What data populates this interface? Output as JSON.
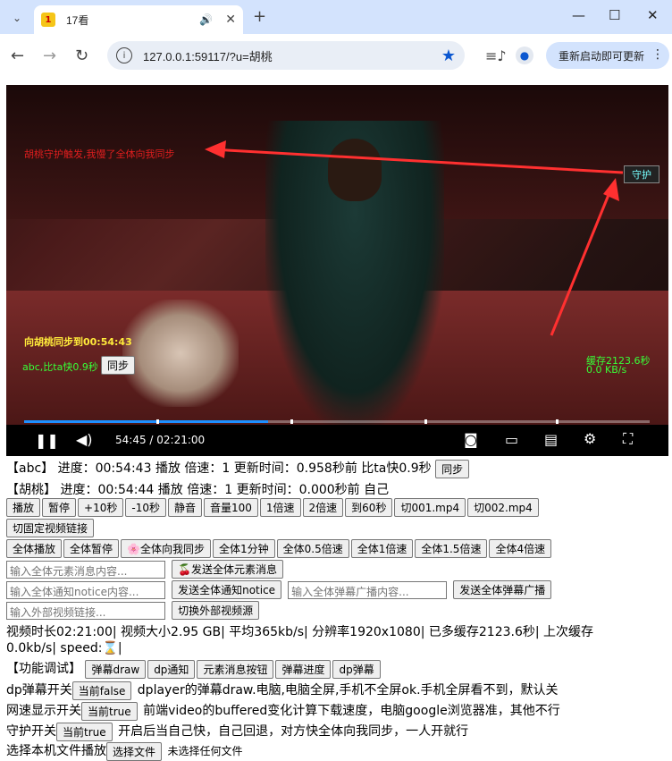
{
  "browser": {
    "tab_title": "17看",
    "url": "127.0.0.1:59117/?u=胡桃",
    "restart_label": "重新启动即可更新"
  },
  "player": {
    "guard_msg": "胡桃守护触发,我慢了全体向我同步",
    "guard_btn": "守护",
    "sync_msg": "向胡桃同步到00:54:43",
    "abc_msg": "abc,比ta快0.9秒",
    "sync_btn": "同步",
    "cache_msg": "缓存2123.6秒",
    "speed_msg": "0.0 KB/s",
    "time": "54:45 / 02:21:00",
    "progress": 0.39
  },
  "status": {
    "abc_line": "【abc】 进度：00:54:43 播放 倍速：1 更新时间：0.958秒前 比ta快0.9秒",
    "abc_btn": "同步",
    "hutao_line": "【胡桃】 进度：00:54:44 播放 倍速：1 更新时间：0.000秒前 自己"
  },
  "row1": [
    "播放",
    "暂停",
    "+10秒",
    "-10秒",
    "静音",
    "音量100",
    "1倍速",
    "2倍速",
    "到60秒",
    "切001.mp4",
    "切002.mp4"
  ],
  "row2": [
    "切固定视频链接"
  ],
  "row3": [
    "全体播放",
    "全体暂停",
    "🌸全体向我同步",
    "全体1分钟",
    "全体0.5倍速",
    "全体1倍速",
    "全体1.5倍速",
    "全体4倍速"
  ],
  "inputs": {
    "elem_ph": "输入全体元素消息内容...",
    "elem_btn": "🍒发送全体元素消息",
    "notice_ph": "输入全体通知notice内容...",
    "notice_btn": "发送全体通知notice",
    "danmu_ph": "输入全体弹幕广播内容...",
    "danmu_btn": "发送全体弹幕广播",
    "ext_ph": "输入外部视频链接...",
    "ext_btn": "切换外部视频源"
  },
  "info": {
    "line1": "视频时长02:21:00| 视频大小2.95 GB| 平均365kb/s| 分辨率1920x1080| 已多缓存2123.6秒| 上次缓存",
    "line2": "0.0kb/s| speed:⌛|"
  },
  "debug": {
    "label": "【功能调试】",
    "btns": [
      "弹幕draw",
      "dp通知",
      "元素消息按钮",
      "弹幕进度",
      "dp弹幕"
    ]
  },
  "toggles": {
    "dp_pre": "dp弹幕开关",
    "dp_btn": "当前false",
    "dp_post": "dplayer的弹幕draw.电脑,电脑全屏,手机不全屏ok.手机全屏看不到，默认关",
    "net_pre": "网速显示开关",
    "net_btn": "当前true",
    "net_post": "前端video的buffered变化计算下载速度，电脑google浏览器准，其他不行",
    "guard_pre": "守护开关",
    "guard_btn": "当前true",
    "guard_post": "开启后当自己快，自己回退，对方快全体向我同步，一人开就行",
    "file_pre": "选择本机文件播放",
    "file_btn": "选择文件",
    "file_post": "未选择任何文件"
  }
}
